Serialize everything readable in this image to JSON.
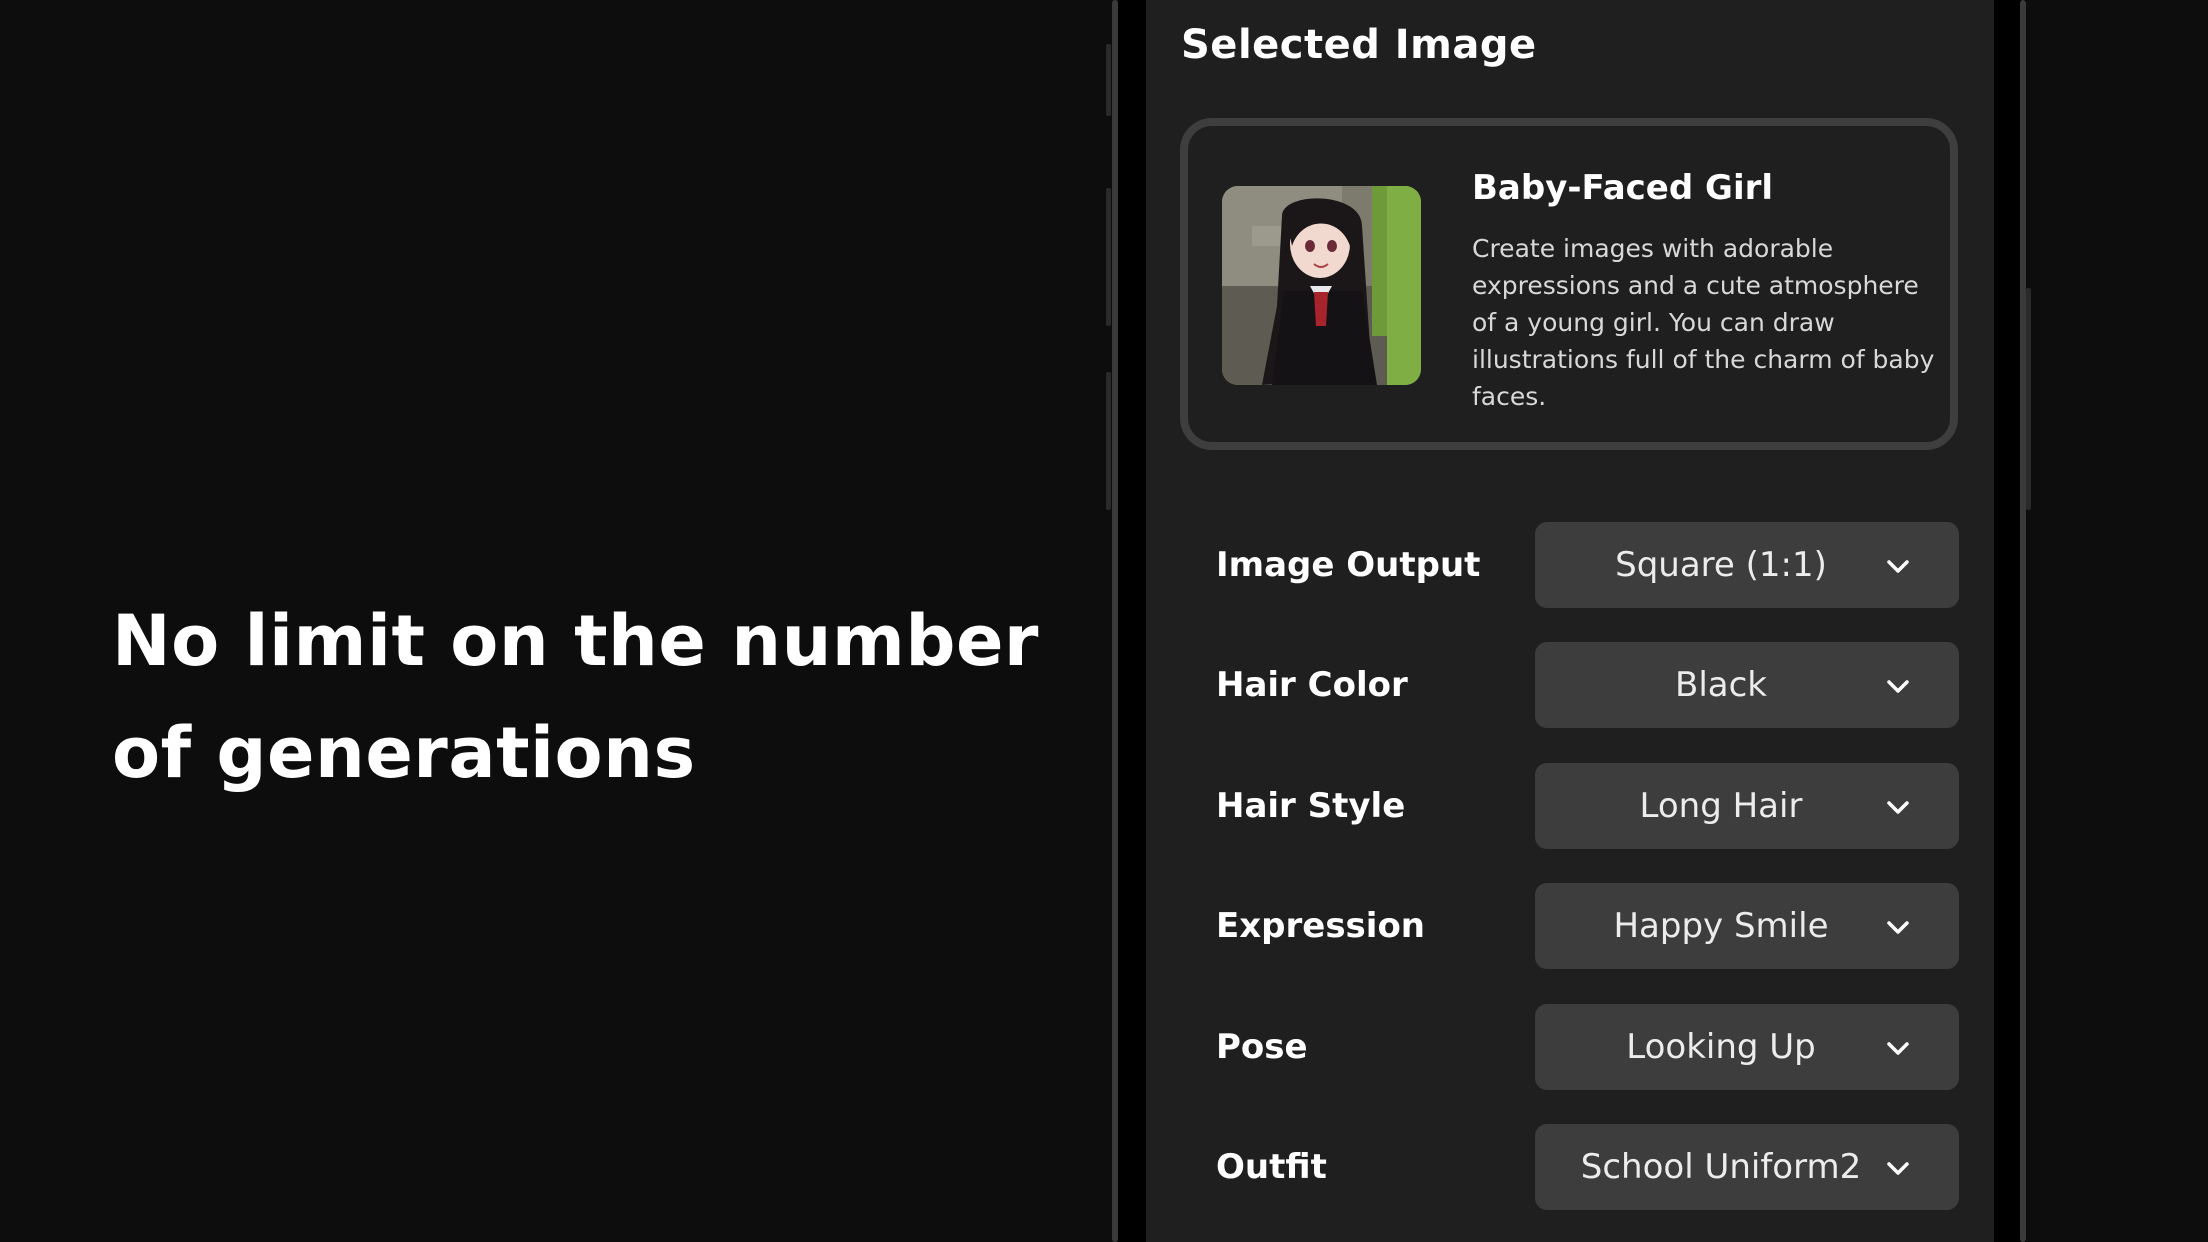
{
  "headline": "No limit on the number of generations",
  "screen": {
    "section_title": "Selected Image",
    "card": {
      "title": "Baby-Faced Girl",
      "description": "Create images with adorable expressions and a cute atmosphere of a young girl. You can draw illustrations full of the charm of baby faces."
    },
    "settings": [
      {
        "label": "Image Output",
        "value": "Square (1:1)"
      },
      {
        "label": "Hair Color",
        "value": "Black"
      },
      {
        "label": "Hair Style",
        "value": "Long Hair"
      },
      {
        "label": "Expression",
        "value": "Happy Smile"
      },
      {
        "label": "Pose",
        "value": "Looking Up"
      },
      {
        "label": "Outfit",
        "value": "School Uniform2"
      }
    ]
  },
  "colors": {
    "background": "#0d0d0d",
    "screen": "#1f1f1f",
    "dropdown": "#3d3d3d",
    "card_border": "#3e3e3e"
  }
}
